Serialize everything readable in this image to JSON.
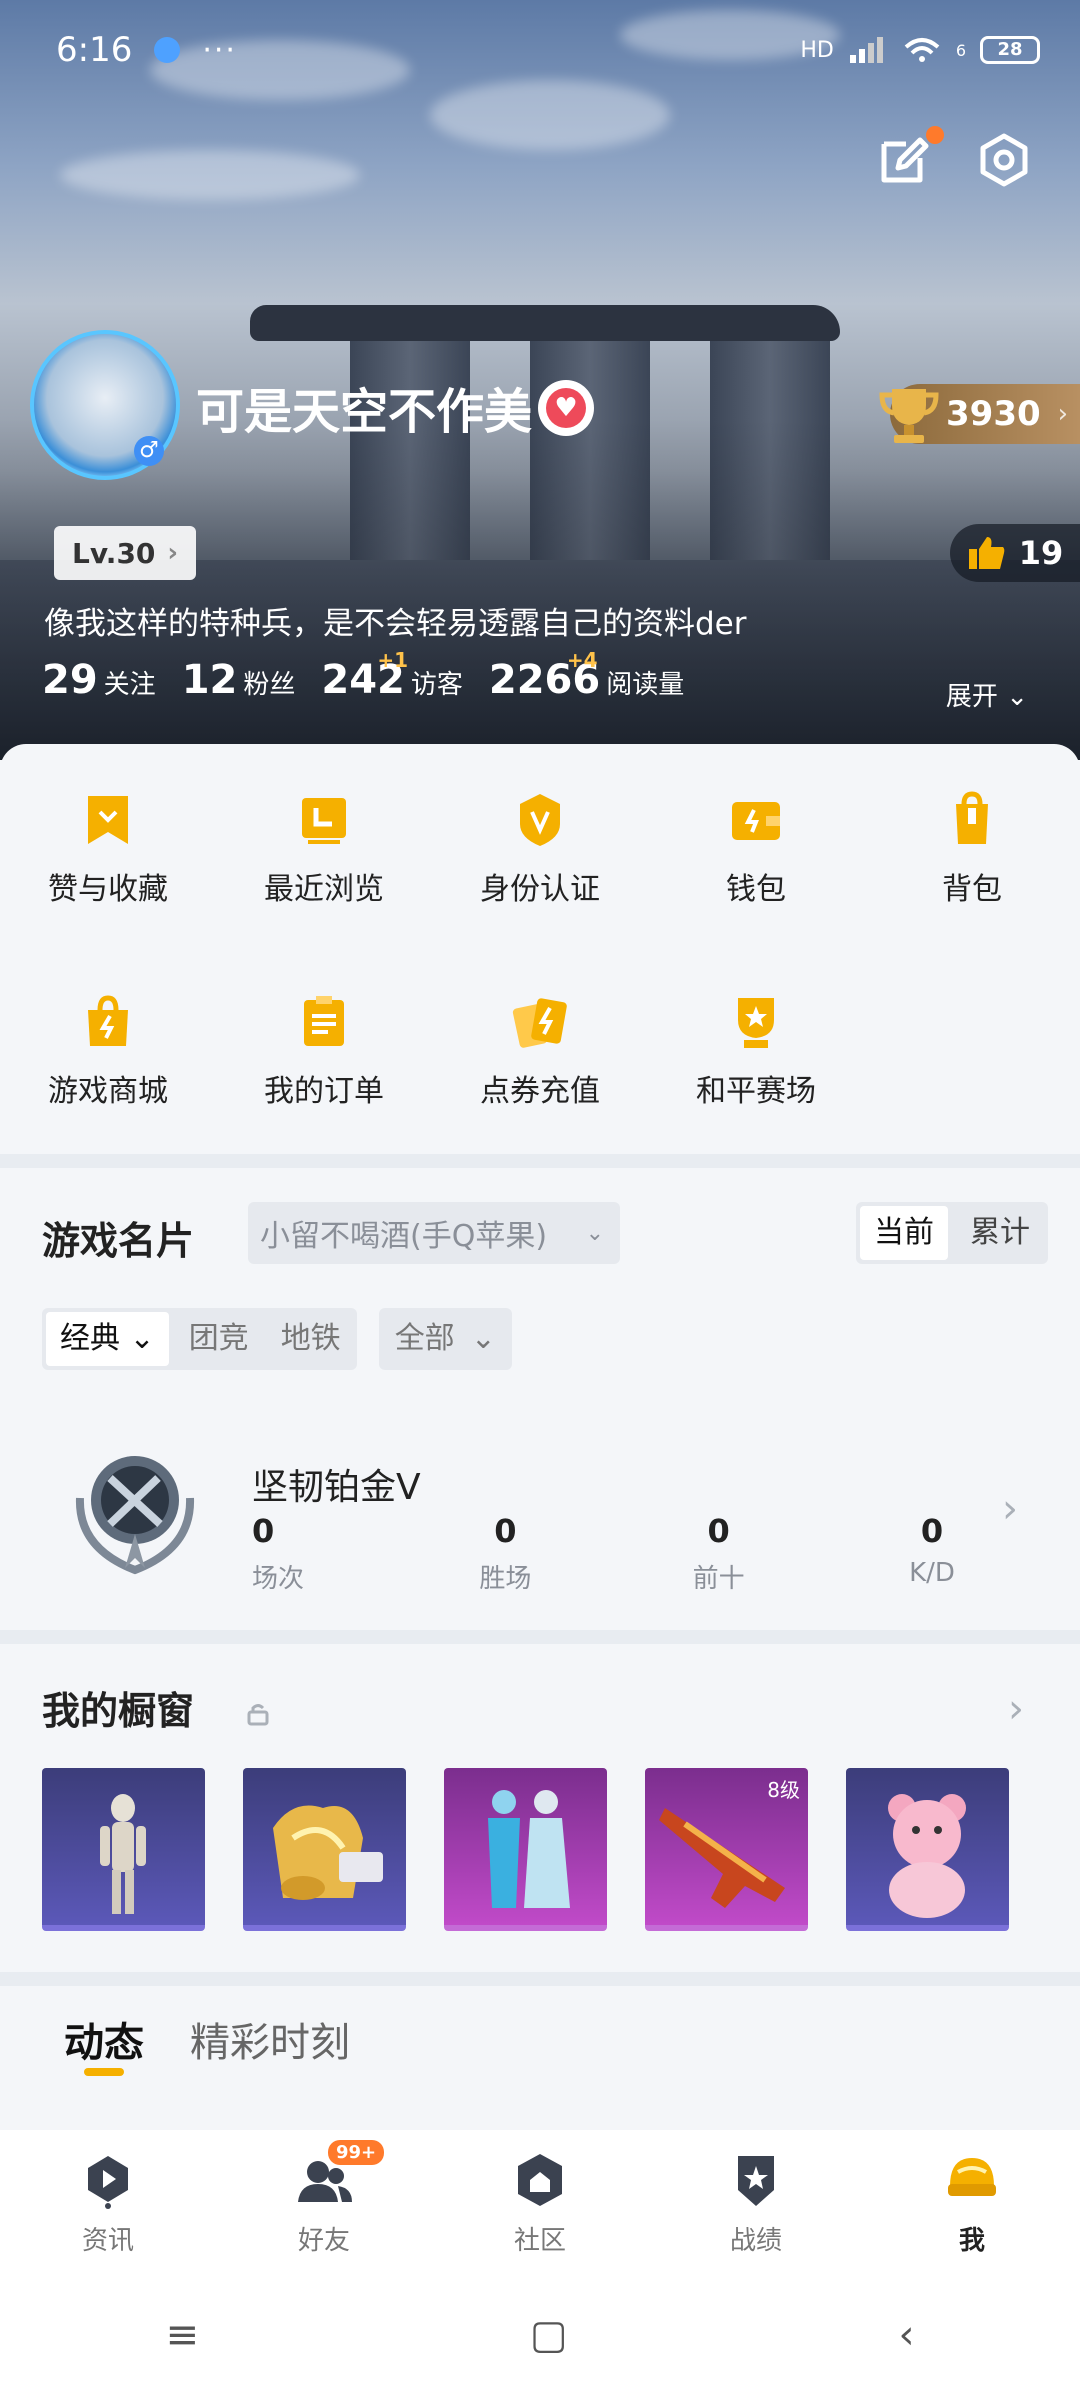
{
  "status_bar": {
    "time": "6:16",
    "dots": "···",
    "network": "HD",
    "wifi_label": "6",
    "battery": "28"
  },
  "profile": {
    "nickname": "可是天空不作美",
    "gender": "♂",
    "trophy_score": "3930",
    "level": "Lv.30",
    "likes": "19",
    "bio": "像我这样的特种兵，是不会轻易透露自己的资料der",
    "stats": [
      {
        "num": "29",
        "label": "关注",
        "plus": ""
      },
      {
        "num": "12",
        "label": "粉丝",
        "plus": ""
      },
      {
        "num": "242",
        "label": "访客",
        "plus": "+1"
      },
      {
        "num": "2266",
        "label": "阅读量",
        "plus": "+4"
      }
    ],
    "expand_label": "展开"
  },
  "menu": {
    "row1": [
      "赞与收藏",
      "最近浏览",
      "身份认证",
      "钱包",
      "背包"
    ],
    "row2": [
      "游戏商城",
      "我的订单",
      "点券充值",
      "和平赛场"
    ]
  },
  "game_card": {
    "title": "游戏名片",
    "account": "小留不喝酒(手Q苹果)",
    "segments": [
      "当前",
      "累计"
    ],
    "modes": [
      "经典",
      "团竞",
      "地铁"
    ],
    "filter": "全部",
    "rank_name": "坚韧铂金V",
    "rank_stats": [
      {
        "value": "0",
        "key": "场次"
      },
      {
        "value": "0",
        "key": "胜场"
      },
      {
        "value": "0",
        "key": "前十"
      },
      {
        "value": "0",
        "key": "K/D"
      }
    ]
  },
  "showcase": {
    "title": "我的橱窗",
    "items": [
      {
        "name": "mummy-outfit",
        "tag": ""
      },
      {
        "name": "gold-set",
        "tag": ""
      },
      {
        "name": "couple-outfit",
        "tag": ""
      },
      {
        "name": "flame-rifle",
        "tag": "8级"
      },
      {
        "name": "pink-bear",
        "tag": ""
      }
    ]
  },
  "feed_tabs": [
    "动态",
    "精彩时刻"
  ],
  "bottom_nav": [
    {
      "label": "资讯",
      "icon": "news-icon"
    },
    {
      "label": "好友",
      "icon": "friends-icon",
      "badge": "99+"
    },
    {
      "label": "社区",
      "icon": "community-icon"
    },
    {
      "label": "战绩",
      "icon": "record-icon"
    },
    {
      "label": "我",
      "icon": "me-icon"
    }
  ],
  "colors": {
    "accent": "#f5b000",
    "badge": "#ff7a2b"
  }
}
